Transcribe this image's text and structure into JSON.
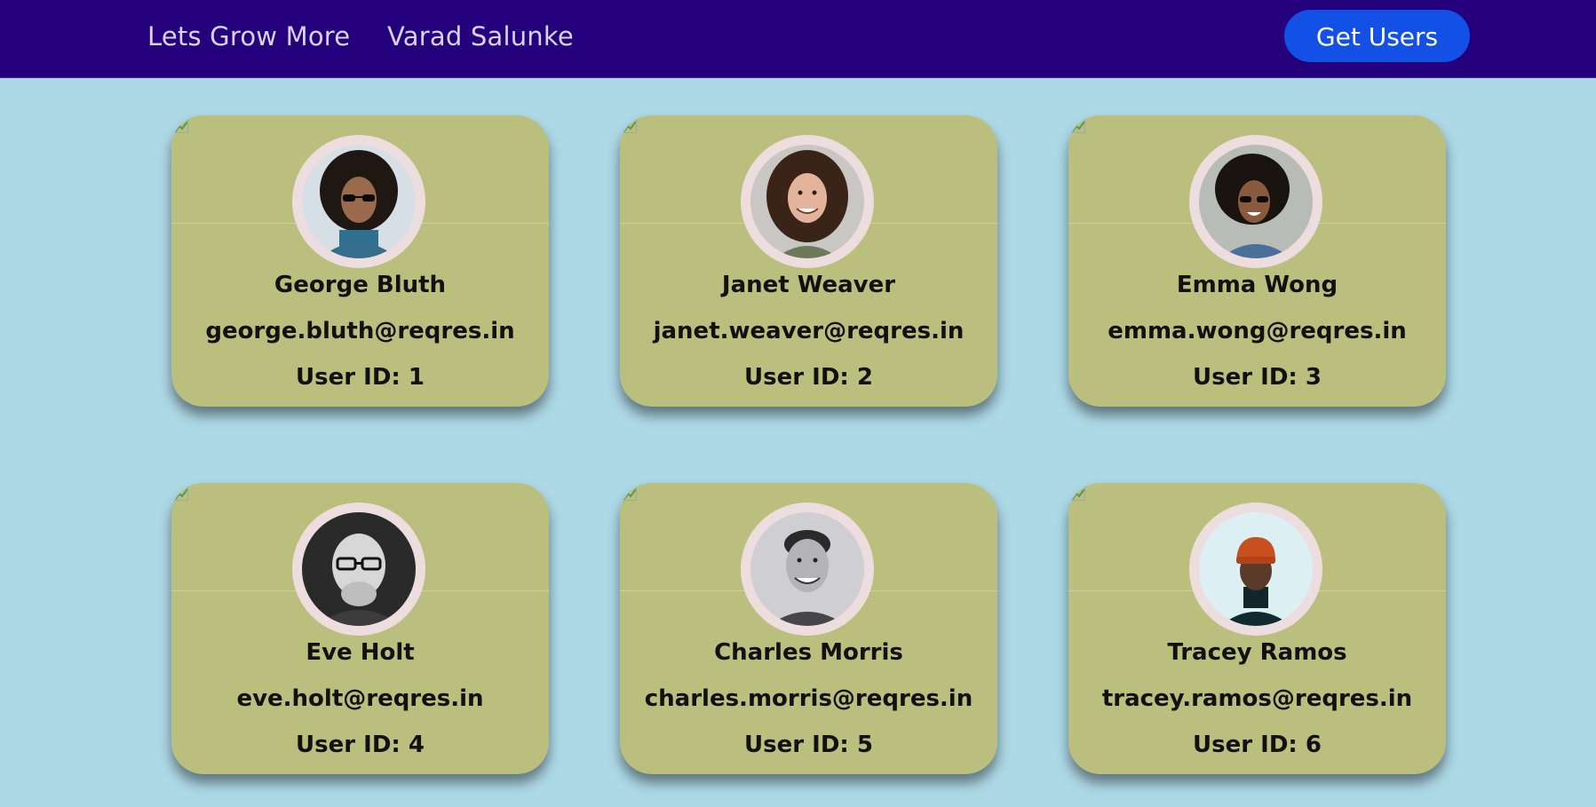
{
  "nav": {
    "brand": "Lets Grow More",
    "author": "Varad Salunke",
    "button_label": "Get Users",
    "bg_color": "#24007c",
    "button_color": "#1350e6"
  },
  "page": {
    "bg_color": "#add8e6",
    "card_color": "#bbbf7d",
    "avatar_ring_color": "#eeddde"
  },
  "users": [
    {
      "name": "George Bluth",
      "email": "george.bluth@reqres.in",
      "id_text": "User ID: 1"
    },
    {
      "name": "Janet Weaver",
      "email": "janet.weaver@reqres.in",
      "id_text": "User ID: 2"
    },
    {
      "name": "Emma Wong",
      "email": "emma.wong@reqres.in",
      "id_text": "User ID: 3"
    },
    {
      "name": "Eve Holt",
      "email": "eve.holt@reqres.in",
      "id_text": "User ID: 4"
    },
    {
      "name": "Charles Morris",
      "email": "charles.morris@reqres.in",
      "id_text": "User ID: 5"
    },
    {
      "name": "Tracey Ramos",
      "email": "tracey.ramos@reqres.in",
      "id_text": "User ID: 6"
    }
  ]
}
